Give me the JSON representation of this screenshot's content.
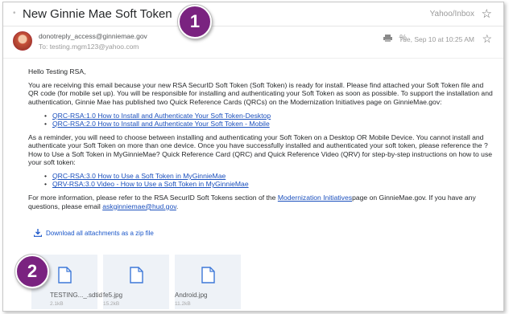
{
  "header": {
    "subject": "New Ginnie Mae Soft Token",
    "folder": "Yahoo/Inbox"
  },
  "sender": {
    "from": "donotreply_access@ginniemae.gov",
    "to": "To: testing.mgm123@yahoo.com",
    "date": "Tue, Sep 10 at 10:25 AM"
  },
  "body": {
    "greeting": "Hello Testing RSA,",
    "para1": "You are receiving this email because your new RSA SecurID Soft Token (Soft Token) is ready for install. Please find attached your Soft Token file and QR code (for mobile set up). You will be responsible for installing and authenticating your Soft Token as soon as possible. To support the installation and authentication, Ginnie Mae has published two Quick Reference Cards (QRCs) on the Modernization Initiatives page on GinnieMae.gov:",
    "links1": [
      "QRC-RSA:1.0 How to Install and Authenticate Your Soft Token-Desktop",
      "QRC-RSA:2.0 How to Install and Authenticate Your Soft Token - Mobile"
    ],
    "para2": "As a reminder, you will need to choose between installing and authenticating your Soft Token on a Desktop OR Mobile Device. You cannot install and authenticate your Soft Token on more than one device. Once you have successfully installed and authenticated your soft token, please reference the ?How to Use a Soft Token in MyGinnieMae? Quick Reference Card (QRC) and Quick Reference Video (QRV) for step-by-step instructions on how to use your soft token:",
    "links2": [
      "QRC-RSA:3.0 How to Use a Soft Token in MyGinnieMae",
      "QRV-RSA:3.0 Video - How to Use a Soft Token in MyGinnieMae"
    ],
    "para3_before": "For more information, please refer to the RSA SecurID Soft Tokens section of the ",
    "para3_link1": "Modernization Initiatives",
    "para3_middle": "page on GinnieMae.gov. If you have any questions, please email ",
    "para3_link2": "askginniemae@hud.gov",
    "para3_end": "."
  },
  "download_all": "Download all attachments as a zip file",
  "attachments": [
    {
      "name": "TESTING..._.sdtid",
      "size": "2.1kB"
    },
    {
      "name": "fe5.jpg",
      "size": "15.2kB"
    },
    {
      "name": "Android.jpg",
      "size": "11.2kB"
    }
  ],
  "badges": [
    "1",
    "2"
  ],
  "icons": {
    "star": "☆",
    "paperclip": "%",
    "bullet": "•"
  },
  "colors": {
    "badge": "#7a2380",
    "link": "#1a4fbd",
    "attachment_bg": "#eef2f7"
  }
}
